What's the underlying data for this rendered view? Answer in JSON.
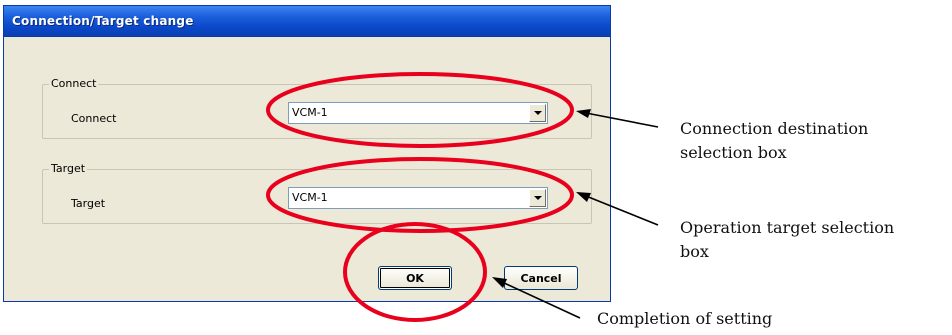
{
  "dialog": {
    "title": "Connection/Target change",
    "connect_group": {
      "legend": "Connect",
      "label": "Connect",
      "value": "VCM-1"
    },
    "target_group": {
      "legend": "Target",
      "label": "Target",
      "value": "VCM-1"
    },
    "ok_label": "OK",
    "cancel_label": "Cancel"
  },
  "annotations": {
    "connection_line1": "Connection destination",
    "connection_line2": "selection box",
    "target_line1": "Operation target selection",
    "target_line2": "box",
    "completion": "Completion of setting"
  },
  "colors": {
    "highlight_ellipse": "#e8001c",
    "arrow": "#000000",
    "titlebar": "#0a49c9"
  },
  "icons": {
    "dropdown": "chevron-down-icon"
  }
}
